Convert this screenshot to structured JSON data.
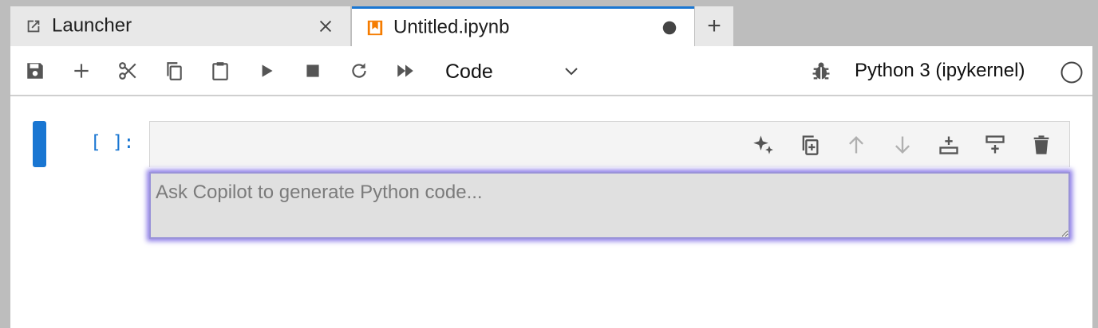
{
  "tabs": [
    {
      "label": "Launcher",
      "icon": "launch-icon",
      "close_icon": "close-icon"
    },
    {
      "label": "Untitled.ipynb",
      "icon": "notebook-icon",
      "modified_icon": "unsaved-dot-icon",
      "active": true
    }
  ],
  "new_tab_label": "+",
  "toolbar": {
    "buttons": [
      "save-icon",
      "add-cell-icon",
      "cut-icon",
      "copy-icon",
      "paste-icon",
      "run-icon",
      "stop-icon",
      "restart-icon",
      "fast-forward-icon"
    ],
    "cell_type": "Code",
    "kernel_name": "Python 3 (ipykernel)",
    "kernel_status_icon": "kernel-idle-circle-icon"
  },
  "cell": {
    "prompt": "[ ]:",
    "toolbar_buttons": [
      "sparkle-icon",
      "duplicate-icon",
      "move-up-icon",
      "move-down-icon",
      "insert-below-icon",
      "insert-above-icon",
      "delete-icon"
    ],
    "input_placeholder": "Ask Copilot to generate Python code..."
  },
  "colors": {
    "accent": "#1976d2",
    "notebook_icon": "#f57c00",
    "copilot_glow": "#8f7fe8"
  }
}
